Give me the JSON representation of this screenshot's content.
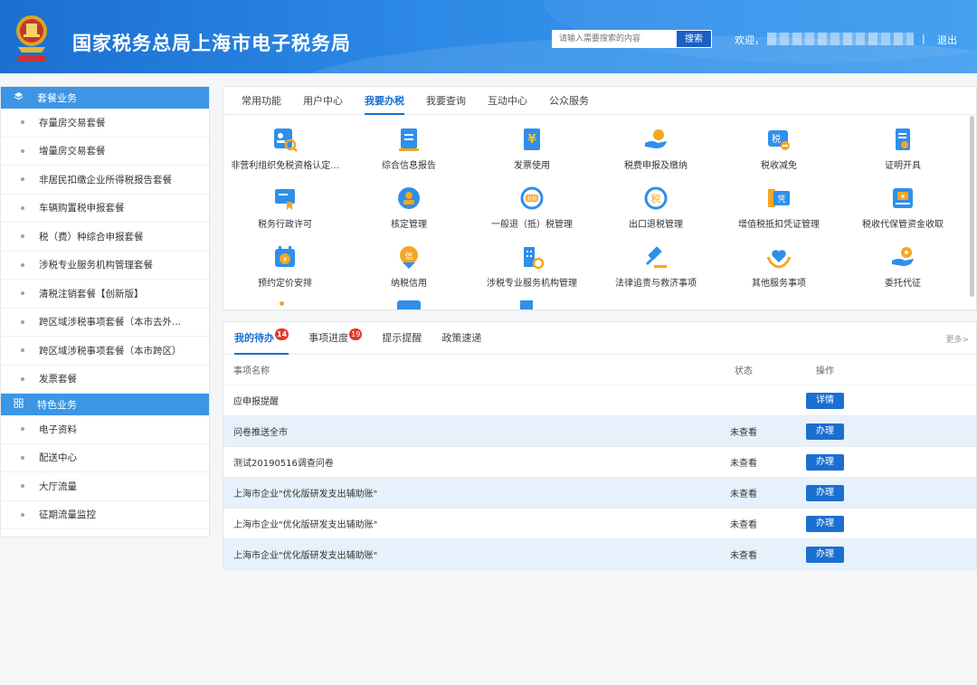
{
  "header": {
    "title": "国家税务总局上海市电子税务局",
    "search_placeholder": "请输入需要搜索的内容",
    "search_button": "搜索",
    "welcome": "欢迎，",
    "separator": "|",
    "logout": "退出"
  },
  "sidebar": {
    "section1": {
      "title": "套餐业务",
      "icon": "layers-icon"
    },
    "items1": [
      {
        "label": "存量房交易套餐"
      },
      {
        "label": "增量房交易套餐"
      },
      {
        "label": "非居民扣缴企业所得税报告套餐"
      },
      {
        "label": "车辆购置税申报套餐"
      },
      {
        "label": "税（费）种综合申报套餐"
      },
      {
        "label": "涉税专业服务机构管理套餐"
      },
      {
        "label": "清税注销套餐【创新版】"
      },
      {
        "label": "跨区域涉税事项套餐（本市去外..."
      },
      {
        "label": "跨区域涉税事项套餐（本市跨区）"
      },
      {
        "label": "发票套餐"
      }
    ],
    "section2": {
      "title": "特色业务",
      "icon": "grid-icon"
    },
    "items2": [
      {
        "label": "电子资料"
      },
      {
        "label": "配送中心"
      },
      {
        "label": "大厅流量"
      },
      {
        "label": "征期流量监控"
      }
    ]
  },
  "service_tabs": [
    {
      "label": "常用功能"
    },
    {
      "label": "用户中心"
    },
    {
      "label": "我要办税",
      "active": true
    },
    {
      "label": "我要查询"
    },
    {
      "label": "互动中心"
    },
    {
      "label": "公众服务"
    }
  ],
  "services": [
    {
      "label": "非营利组织免税资格认定...",
      "icon": "id-search-icon"
    },
    {
      "label": "综合信息报告",
      "icon": "document-icon"
    },
    {
      "label": "发票使用",
      "icon": "invoice-yuan-icon"
    },
    {
      "label": "税费申报及缴纳",
      "icon": "hand-coin-icon"
    },
    {
      "label": "税收减免",
      "icon": "tax-reduce-icon"
    },
    {
      "label": "证明开具",
      "icon": "certificate-icon"
    },
    {
      "label": "税务行政许可",
      "icon": "license-icon"
    },
    {
      "label": "核定管理",
      "icon": "stamp-icon"
    },
    {
      "label": "一般退（抵）税管理",
      "icon": "refund-icon"
    },
    {
      "label": "出口退税管理",
      "icon": "export-tax-icon"
    },
    {
      "label": "增值税抵扣凭证管理",
      "icon": "voucher-icon"
    },
    {
      "label": "税收代保管资金收取",
      "icon": "fund-icon"
    },
    {
      "label": "预约定价安排",
      "icon": "calendar-yuan-icon"
    },
    {
      "label": "纳税信用",
      "icon": "credit-icon"
    },
    {
      "label": "涉税专业服务机构管理",
      "icon": "building-gear-icon"
    },
    {
      "label": "法律追责与救济事项",
      "icon": "gavel-icon"
    },
    {
      "label": "其他服务事项",
      "icon": "heart-hand-icon"
    },
    {
      "label": "委托代征",
      "icon": "hand-pin-icon"
    }
  ],
  "tasks": {
    "tabs": [
      {
        "label": "我的待办",
        "badge": "14",
        "active": true
      },
      {
        "label": "事项进度",
        "badge": "19"
      },
      {
        "label": "提示提醒"
      },
      {
        "label": "政策速递"
      }
    ],
    "more": "更多>",
    "columns": {
      "name": "事项名称",
      "status": "状态",
      "op": "操作"
    },
    "rows": [
      {
        "name": "应申报提醒",
        "status": "",
        "op": "详情"
      },
      {
        "name": "问卷推送全市",
        "status": "未查看",
        "op": "办理"
      },
      {
        "name": "测试20190516调查问卷",
        "status": "未查看",
        "op": "办理"
      },
      {
        "name": "上海市企业\"优化版研发支出辅助账\"",
        "status": "未查看",
        "op": "办理"
      },
      {
        "name": "上海市企业\"优化版研发支出辅助账\"",
        "status": "未查看",
        "op": "办理"
      },
      {
        "name": "上海市企业\"优化版研发支出辅助账\"",
        "status": "未查看",
        "op": "办理"
      }
    ]
  },
  "colors": {
    "header_blue": "#1b6fd1",
    "accent_blue": "#3c95e5",
    "icon_blue": "#2f8fea",
    "icon_orange": "#f5a623",
    "badge_red": "#e0382e",
    "row_alt": "#e7f1fb"
  }
}
